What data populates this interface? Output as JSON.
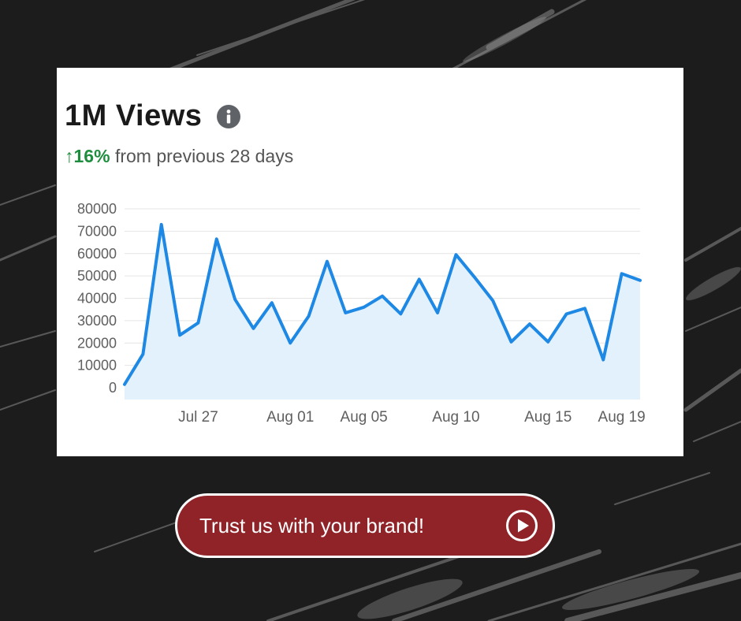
{
  "headline": {
    "title": "1M Views",
    "change_arrow": "↑",
    "change_value": "16%",
    "change_text": "from previous 28 days"
  },
  "icons": {
    "info": "info-icon",
    "play": "play-circle-icon"
  },
  "colors": {
    "line": "#1e88e5",
    "area": "#e3f1fd",
    "positive": "#1e8e3e",
    "cta_background": "#8f2328"
  },
  "cta": {
    "label": "Trust us with your brand!"
  },
  "chart_data": {
    "type": "area",
    "title": "",
    "xlabel": "",
    "ylabel": "",
    "ylim": [
      0,
      80000
    ],
    "yticks": [
      0,
      10000,
      20000,
      30000,
      40000,
      50000,
      60000,
      70000,
      80000
    ],
    "xticks": [
      "Jul 27",
      "Aug 01",
      "Aug 05",
      "Aug 10",
      "Aug 15",
      "Aug 19"
    ],
    "x": [
      "Jul 23",
      "Jul 24",
      "Jul 25",
      "Jul 26",
      "Jul 27",
      "Jul 28",
      "Jul 29",
      "Jul 30",
      "Jul 31",
      "Aug 01",
      "Aug 02",
      "Aug 03",
      "Aug 04",
      "Aug 05",
      "Aug 06",
      "Aug 07",
      "Aug 08",
      "Aug 09",
      "Aug 10",
      "Aug 11",
      "Aug 12",
      "Aug 13",
      "Aug 14",
      "Aug 15",
      "Aug 16",
      "Aug 17",
      "Aug 18",
      "Aug 19",
      "Aug 20"
    ],
    "values": [
      1500,
      15000,
      73000,
      23500,
      29000,
      66500,
      39500,
      26500,
      38000,
      20000,
      32000,
      56500,
      33500,
      36000,
      41000,
      33000,
      48500,
      33500,
      59500,
      49500,
      39000,
      20500,
      28500,
      20500,
      33000,
      35500,
      12500,
      51000,
      48000
    ],
    "grid": true,
    "legend": "none"
  }
}
